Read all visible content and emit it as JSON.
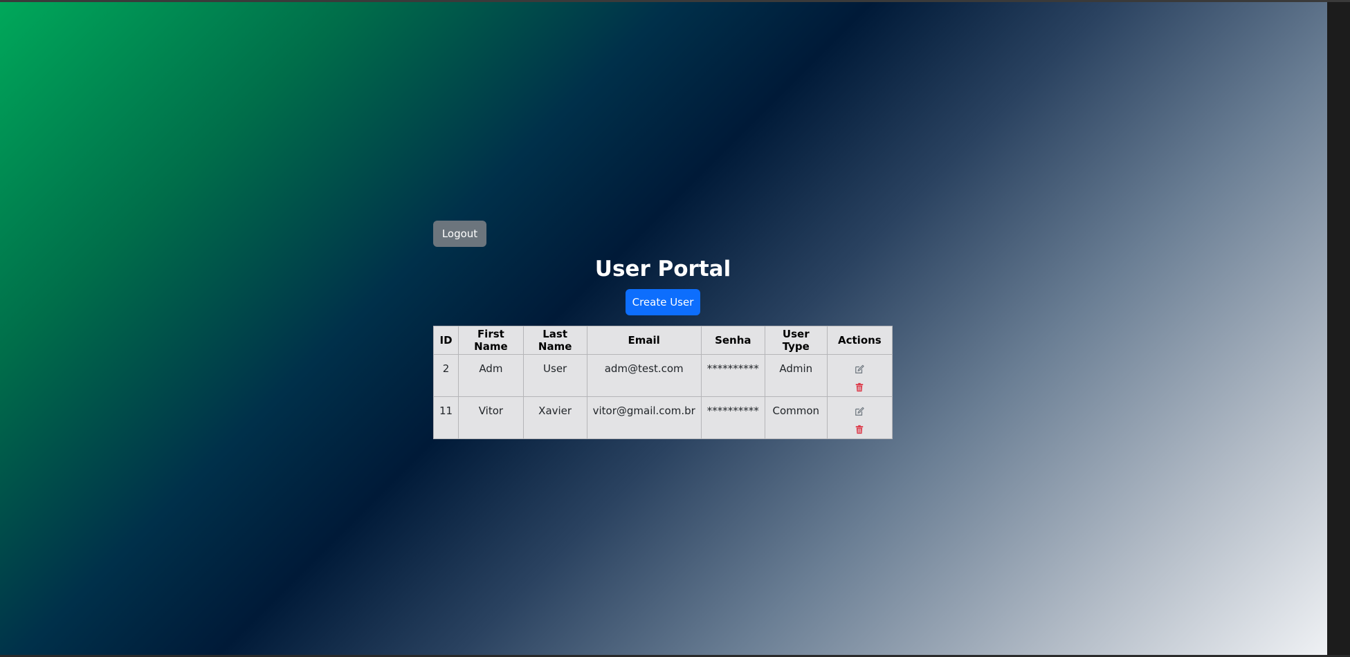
{
  "header": {
    "logout_label": "Logout",
    "title": "User Portal",
    "create_label": "Create User"
  },
  "table": {
    "columns": [
      "ID",
      "First Name",
      "Last Name",
      "Email",
      "Senha",
      "User Type",
      "Actions"
    ],
    "rows": [
      {
        "id": "2",
        "first_name": "Adm",
        "last_name": "User",
        "email": "adm@test.com",
        "senha": "**********",
        "user_type": "Admin"
      },
      {
        "id": "11",
        "first_name": "Vitor",
        "last_name": "Xavier",
        "email": "vitor@gmail.com.br",
        "senha": "**********",
        "user_type": "Common"
      }
    ]
  },
  "icons": {
    "edit": "edit-icon",
    "delete": "trash-icon"
  },
  "colors": {
    "primary": "#0d6efd",
    "secondary": "#6c757d",
    "danger": "#dc3545"
  }
}
